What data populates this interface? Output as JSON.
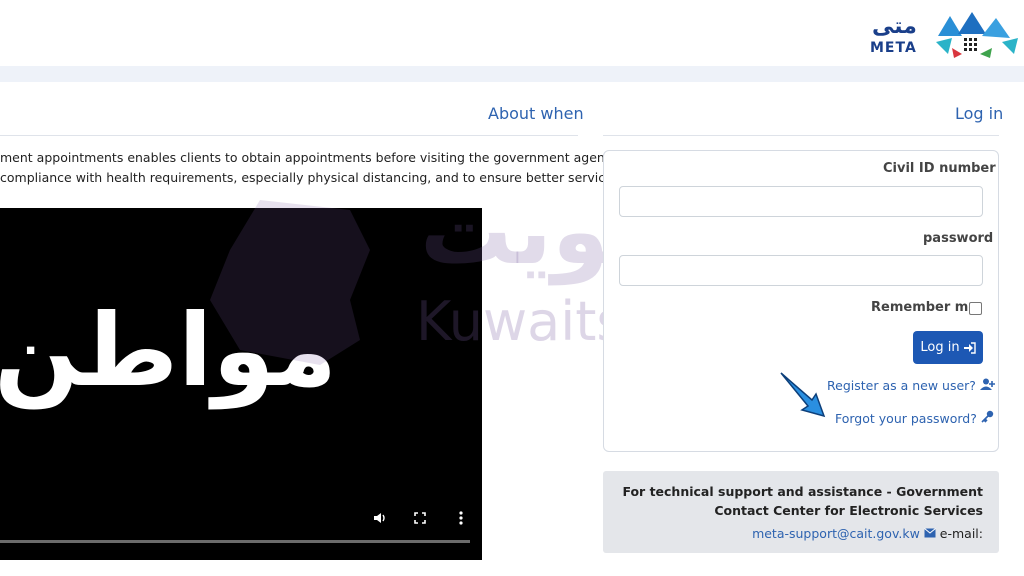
{
  "header": {
    "logo_arabic": "متى",
    "logo_latin": "META"
  },
  "about": {
    "title": "About when",
    "line1": "ment appointments enables clients to obtain appointments before visiting the government agency",
    "line2": "compliance with health requirements, especially physical distancing, and to ensure better service."
  },
  "video": {
    "overlay_text": "مواطن",
    "controls": [
      "volume-icon",
      "fullscreen-icon",
      "more-icon"
    ]
  },
  "login": {
    "title": "Log in",
    "civil_id_label": "Civil ID number",
    "civil_id_value": "",
    "password_label": "password",
    "password_value": "",
    "remember_label": "Remember me",
    "button_label": "Log in",
    "register_link": "Register as a new user?",
    "forgot_link": "Forgot your password?"
  },
  "support": {
    "line1": "For technical support and assistance - Government",
    "line2": "Contact Center for Electronic Services",
    "email": "meta-support@cait.gov.kw",
    "email_label": "e-mail:"
  },
  "watermark": {
    "arabic": "الكويت",
    "english": "Kuwaits Expat"
  },
  "colors": {
    "brand_blue": "#1d58b4",
    "link_blue": "#2e63b0",
    "page_bg": "#eef2f9",
    "support_bg": "#e4e6ea"
  }
}
